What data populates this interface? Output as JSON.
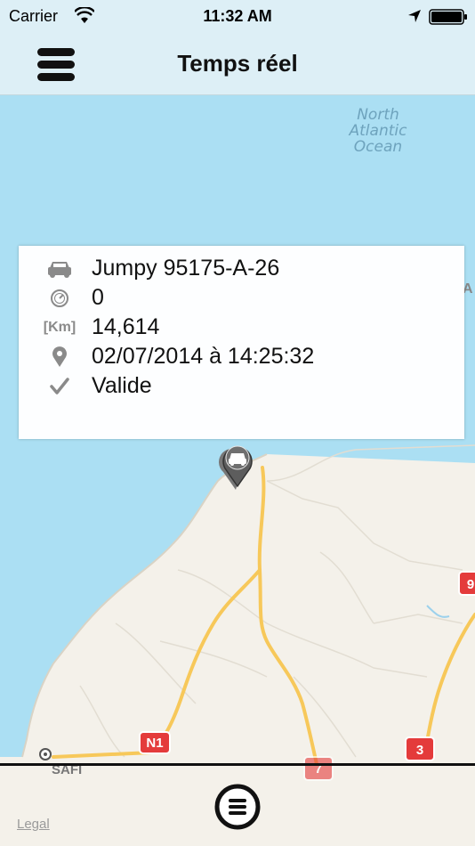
{
  "status_bar": {
    "carrier": "Carrier",
    "time": "11:32 AM",
    "icons": [
      "wifi-icon",
      "location-arrow-icon",
      "battery-icon"
    ]
  },
  "nav_bar": {
    "title": "Temps réel",
    "menu_icon": "hamburger-menu-icon"
  },
  "map": {
    "ocean_label_lines": [
      "North",
      "Atlantic",
      "Ocean"
    ],
    "city_label": "SAFI",
    "legal": "Legal",
    "road_shields": [
      {
        "label": "N1",
        "color": "#e43b3b"
      },
      {
        "label": "7",
        "color": "#e43b3b"
      },
      {
        "label": "3",
        "color": "#e43b3b"
      },
      {
        "label": "9",
        "color": "#e43b3b"
      }
    ],
    "partial_label": "A",
    "colors": {
      "water": "#abdff3",
      "land": "#f4f1ea",
      "road": "#f7c85a"
    }
  },
  "info_card": {
    "rows": [
      {
        "icon": "car-icon",
        "text": "Jumpy 95175-A-26"
      },
      {
        "icon": "speedometer-icon",
        "text": "0"
      },
      {
        "icon": "km-icon",
        "icon_text": "[Km]",
        "text": "14,614"
      },
      {
        "icon": "map-pin-icon",
        "text": "02/07/2014 à 14:25:32"
      },
      {
        "icon": "checkmark-icon",
        "text": "Valide"
      }
    ]
  },
  "bottom": {
    "center_icon": "list-circle-icon"
  }
}
